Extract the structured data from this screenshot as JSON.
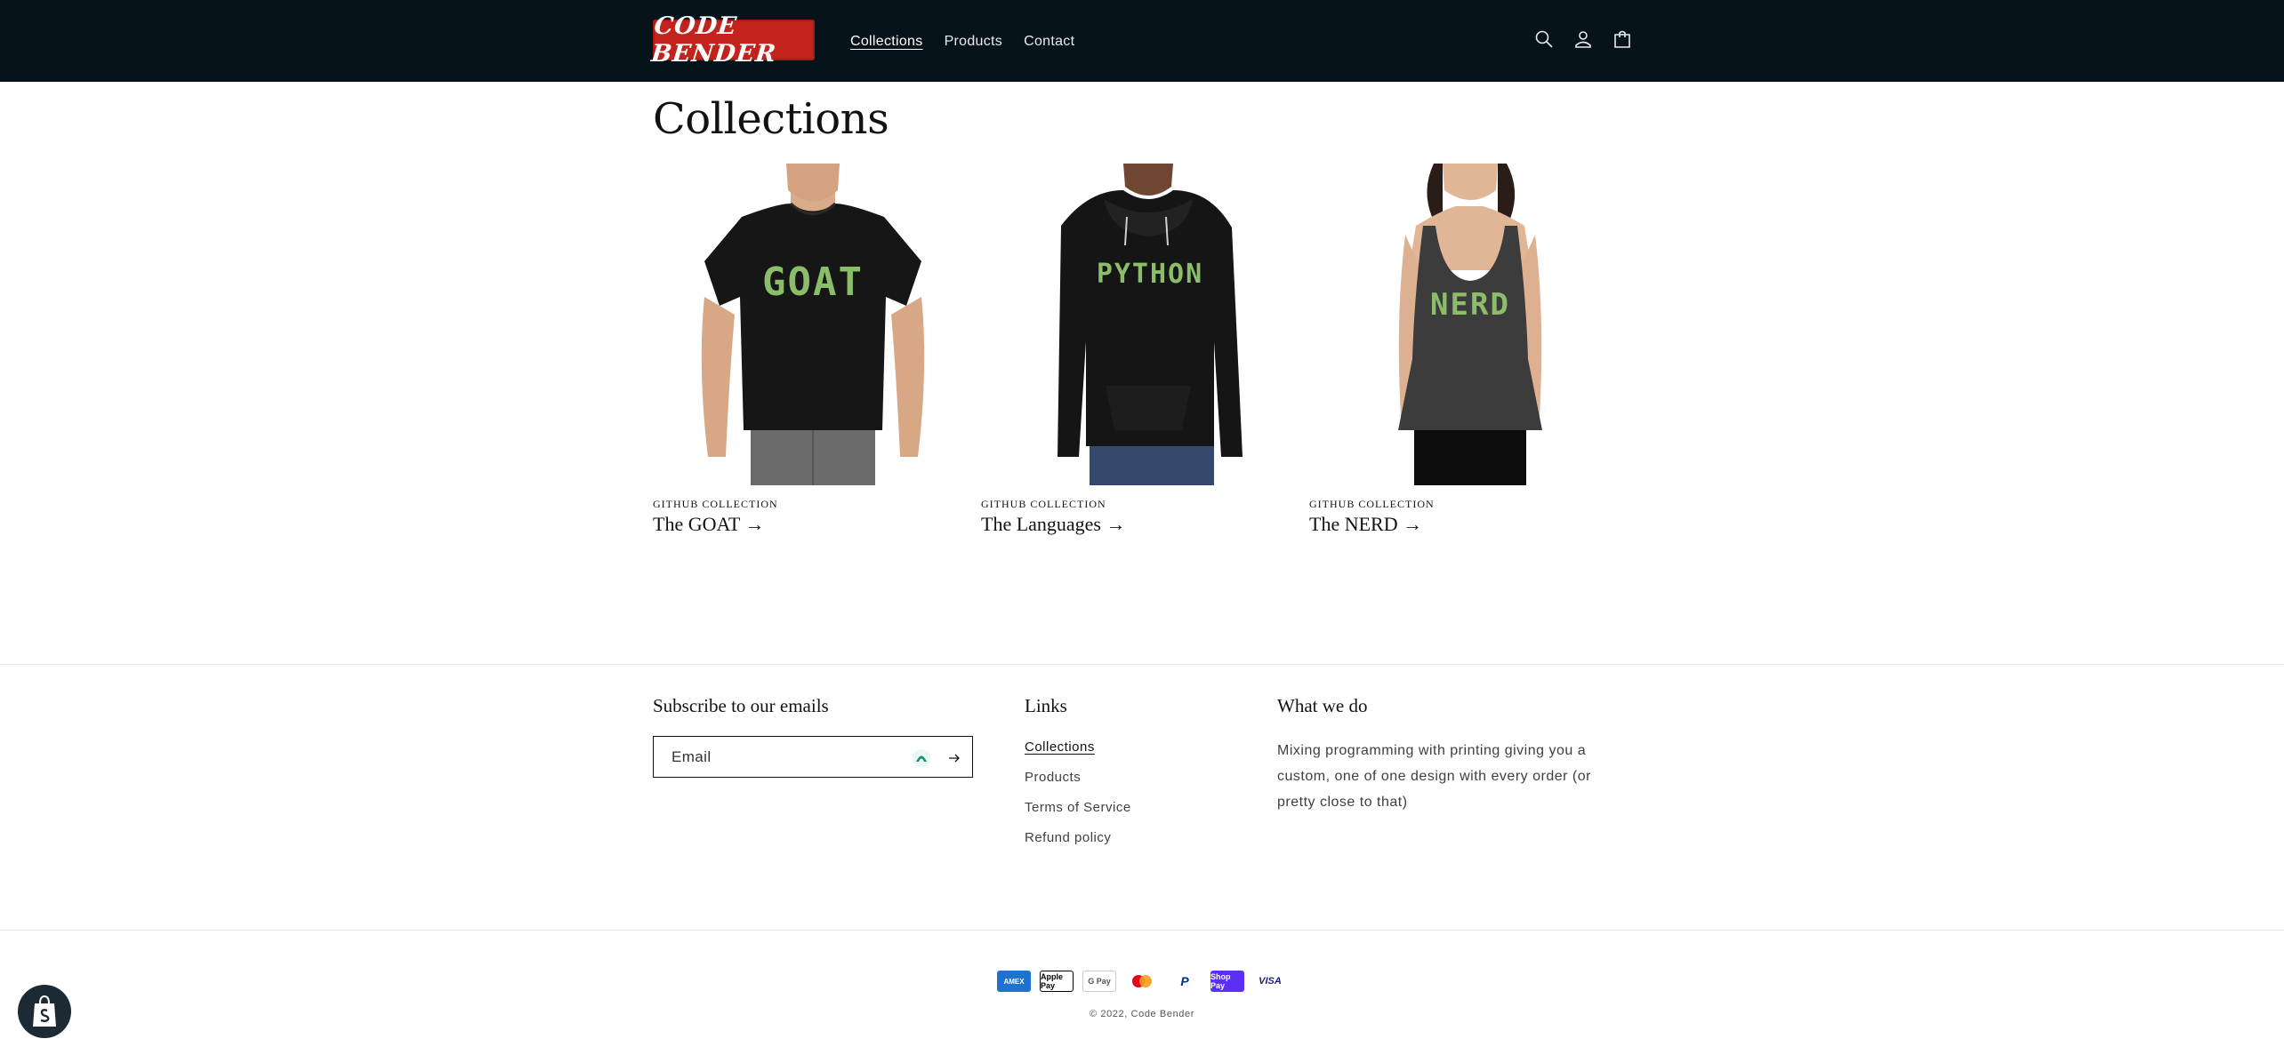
{
  "header": {
    "logo_text": "CODE BENDER",
    "nav": [
      {
        "label": "Collections",
        "active": true
      },
      {
        "label": "Products",
        "active": false
      },
      {
        "label": "Contact",
        "active": false
      }
    ],
    "icons": [
      "search-icon",
      "account-icon",
      "cart-icon"
    ]
  },
  "main": {
    "title": "Collections",
    "collections": [
      {
        "label": "GITHUB COLLECTION",
        "title": "The GOAT →",
        "garment_text": "GOAT",
        "garment": "t-shirt"
      },
      {
        "label": "GITHUB COLLECTION",
        "title": "The Languages →",
        "garment_text": "PYTHON",
        "garment": "hoodie"
      },
      {
        "label": "GITHUB COLLECTION",
        "title": "The NERD →",
        "garment_text": "NERD",
        "garment": "tank-top"
      }
    ]
  },
  "footer": {
    "subscribe": {
      "heading": "Subscribe to our emails",
      "placeholder": "Email"
    },
    "links": {
      "heading": "Links",
      "items": [
        "Collections",
        "Products",
        "Terms of Service",
        "Refund policy"
      ]
    },
    "about": {
      "heading": "What we do",
      "text": "Mixing programming with printing giving you a custom, one of one design with every order (or pretty close to that)"
    },
    "payments": [
      "AMEX",
      "Apple Pay",
      "G Pay",
      "Mastercard",
      "PayPal",
      "Shop Pay",
      "VISA"
    ],
    "copyright": "© 2022, Code Bender"
  },
  "colors": {
    "header_bg": "#06131b",
    "logo_bg": "#c2231c",
    "print_green": "#8bbd6b"
  }
}
